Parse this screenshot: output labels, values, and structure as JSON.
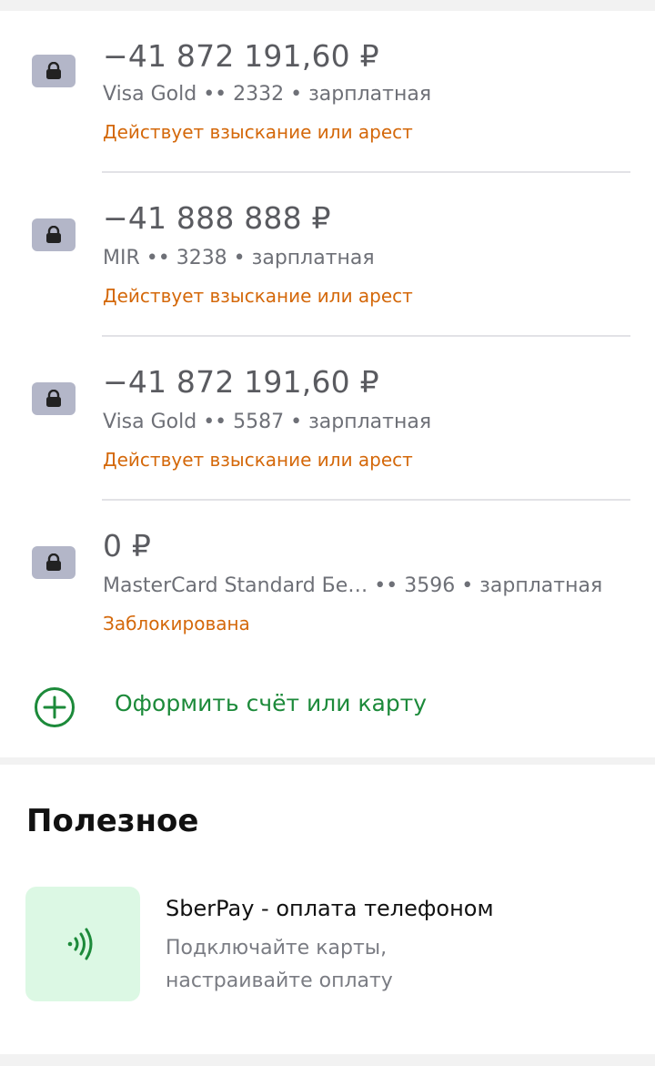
{
  "accounts": [
    {
      "amount": "−41 872 191,60 ₽",
      "description": "Visa Gold •• 2332 • зарплатная",
      "status": "Действует взыскание или арест",
      "icon": "lock-icon"
    },
    {
      "amount": "−41 888 888 ₽",
      "description": "MIR •• 3238 • зарплатная",
      "status": "Действует взыскание или арест",
      "icon": "lock-icon"
    },
    {
      "amount": "−41 872 191,60 ₽",
      "description": "Visa Gold •• 5587 • зарплатная",
      "status": "Действует взыскание или арест",
      "icon": "lock-icon"
    },
    {
      "amount": "0 ₽",
      "description": "MasterCard Standard Бе… •• 3596 • зарплатная",
      "status": "Заблокирована",
      "icon": "lock-icon"
    }
  ],
  "add_account": {
    "label": "Оформить счёт или карту",
    "icon": "plus-circle-icon"
  },
  "useful": {
    "title": "Полезное",
    "items": [
      {
        "title": "SberPay - оплата телефоном",
        "subtitle_line1": "Подключайте карты,",
        "subtitle_line2": "настраивайте оплату",
        "icon": "contactless-icon"
      }
    ]
  },
  "colors": {
    "lock_bg": "#b3b6c8",
    "status_orange": "#d4680a",
    "accent_green": "#1c8a3a",
    "promo_bg": "#dcf8e4"
  }
}
